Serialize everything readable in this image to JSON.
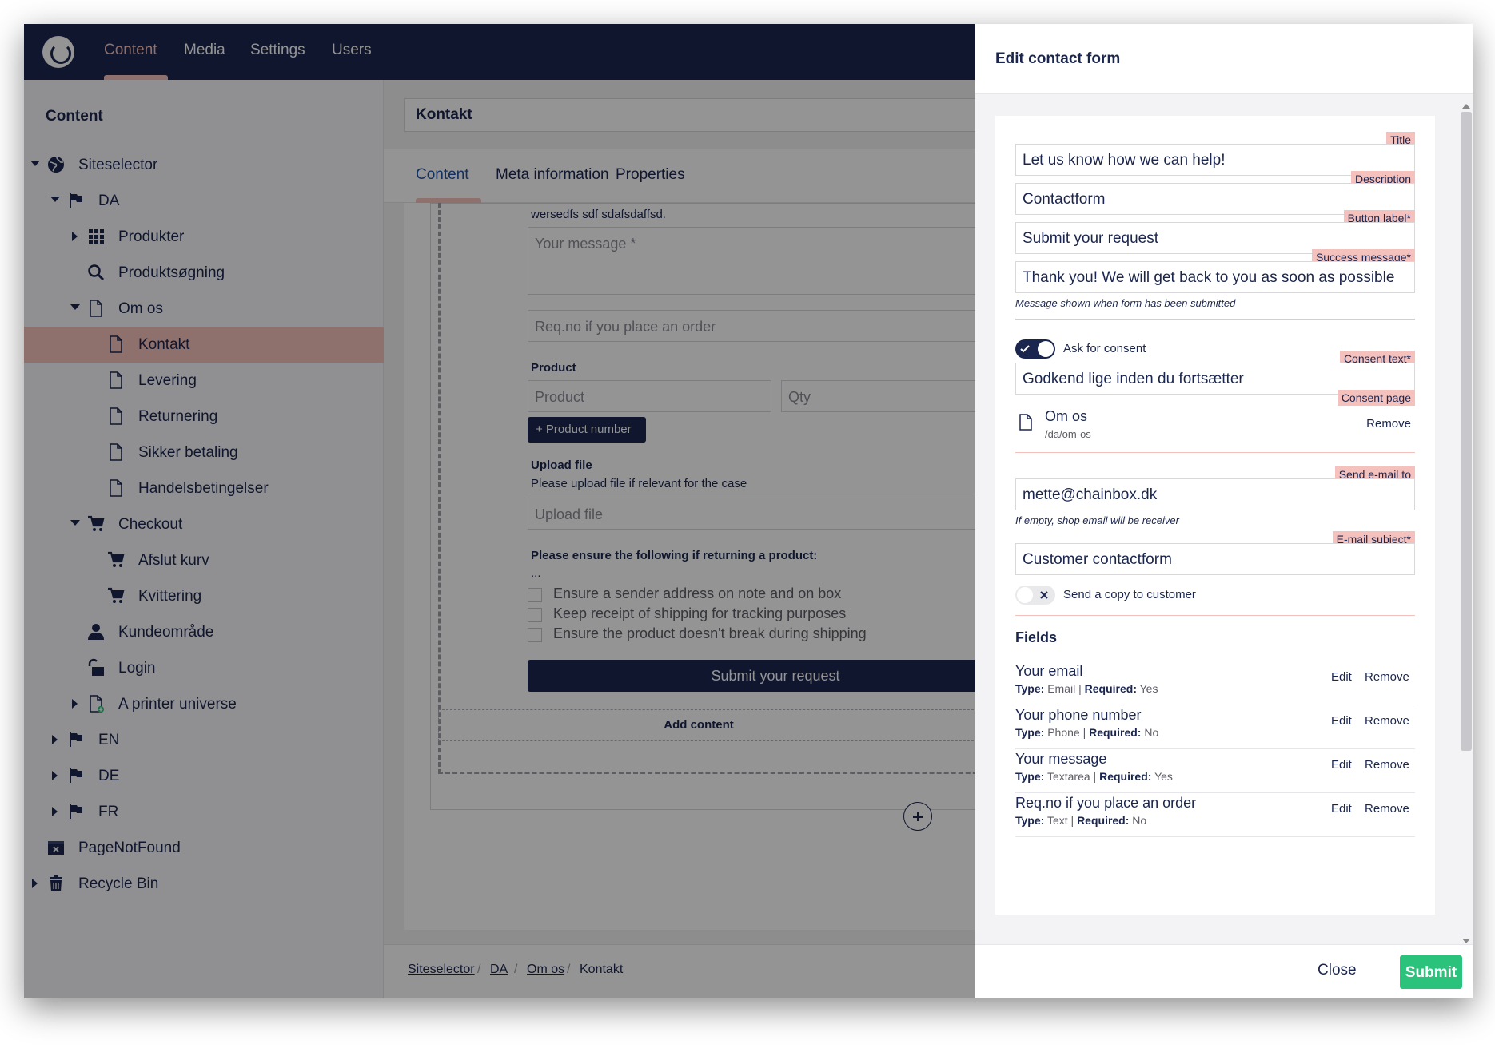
{
  "topnav": {
    "items": [
      "Content",
      "Media",
      "Settings",
      "Users"
    ]
  },
  "sidebar": {
    "title": "Content",
    "tree": [
      {
        "label": "Siteselector",
        "icon": "globe-icon"
      },
      {
        "label": "DA",
        "icon": "flag-icon"
      },
      {
        "label": "Produkter",
        "icon": "grid-icon"
      },
      {
        "label": "Produktsøgning",
        "icon": "search-icon"
      },
      {
        "label": "Om os",
        "icon": "document-icon"
      },
      {
        "label": "Kontakt",
        "icon": "document-icon"
      },
      {
        "label": "Levering",
        "icon": "document-icon"
      },
      {
        "label": "Returnering",
        "icon": "document-icon"
      },
      {
        "label": "Sikker betaling",
        "icon": "document-icon"
      },
      {
        "label": "Handelsbetingelser",
        "icon": "document-icon"
      },
      {
        "label": "Checkout",
        "icon": "cart-icon"
      },
      {
        "label": "Afslut kurv",
        "icon": "cart-icon"
      },
      {
        "label": "Kvittering",
        "icon": "cart-icon"
      },
      {
        "label": "Kundeområde",
        "icon": "user-icon"
      },
      {
        "label": "Login",
        "icon": "unlock-icon"
      },
      {
        "label": "A printer universe",
        "icon": "document-add-icon"
      },
      {
        "label": "EN",
        "icon": "flag-icon"
      },
      {
        "label": "DE",
        "icon": "flag-icon"
      },
      {
        "label": "FR",
        "icon": "flag-icon"
      },
      {
        "label": "PageNotFound",
        "icon": "not-found-icon"
      },
      {
        "label": "Recycle Bin",
        "icon": "trash-icon"
      }
    ]
  },
  "main": {
    "node_name": "Kontakt",
    "tabs": [
      "Content",
      "Meta information",
      "Properties"
    ],
    "preview": {
      "text_line": "wersedfs sdf sdafsdaffsd.",
      "message_placeholder": "Your message *",
      "reqno_placeholder": "Req.no if you place an order",
      "product_label": "Product",
      "product_placeholder": "Product",
      "qty_placeholder": "Qty",
      "product_number_button": "+ Product number",
      "upload_label": "Upload file",
      "upload_help": "Please upload file if relevant for the case",
      "upload_placeholder": "Upload file",
      "ensure_title": "Please ensure the following if returning a product:",
      "ellipsis": "...",
      "checks": [
        "Ensure a sender address on note and on box",
        "Keep receipt of shipping for tracking purposes",
        "Ensure the product doesn't break during shipping"
      ],
      "submit_label": "Submit your request"
    },
    "add_content_label": "Add content",
    "breadcrumb": [
      "Siteselector",
      "DA",
      "Om os",
      "Kontakt"
    ]
  },
  "panel": {
    "title": "Edit contact form",
    "title_field": {
      "tag": "Title",
      "value": "Let us know how we can help!"
    },
    "description_field": {
      "tag": "Description",
      "value": "Contactform"
    },
    "button_field": {
      "tag": "Button label*",
      "value": "Submit your request"
    },
    "success_field": {
      "tag": "Success message*",
      "value": "Thank you! We will get back to you as soon as possible",
      "help": "Message shown when form has been submitted"
    },
    "consent_toggle": {
      "label": "Ask for consent",
      "on": true
    },
    "consent_text_field": {
      "tag": "Consent text*",
      "value": "Godkend lige inden du fortsætter"
    },
    "consent_page": {
      "tag": "Consent page",
      "name": "Om os",
      "url": "/da/om-os",
      "remove": "Remove"
    },
    "email_field": {
      "tag": "Send e-mail to",
      "value": "mette@chainbox.dk",
      "help": "If empty, shop email will be receiver"
    },
    "subject_field": {
      "tag": "E-mail subject*",
      "value": "Customer contactform"
    },
    "copy_toggle": {
      "label": "Send a copy to customer",
      "on": false
    },
    "fields_title": "Fields",
    "type_label": "Type:",
    "required_label": "Required:",
    "edit_label": "Edit",
    "remove_label": "Remove",
    "fields": [
      {
        "name": "Your email",
        "type": "Email",
        "required": "Yes"
      },
      {
        "name": "Your phone number",
        "type": "Phone",
        "required": "No"
      },
      {
        "name": "Your message",
        "type": "Textarea",
        "required": "Yes"
      },
      {
        "name": "Req.no if you place an order",
        "type": "Text",
        "required": "No"
      }
    ],
    "close_label": "Close",
    "submit_label": "Submit"
  },
  "colors": {
    "navy": "#1b264f",
    "accent_pink": "#f5c1bc",
    "submit_green": "#2bc37c",
    "overlay": "rgba(0,0,0,0.42)"
  }
}
